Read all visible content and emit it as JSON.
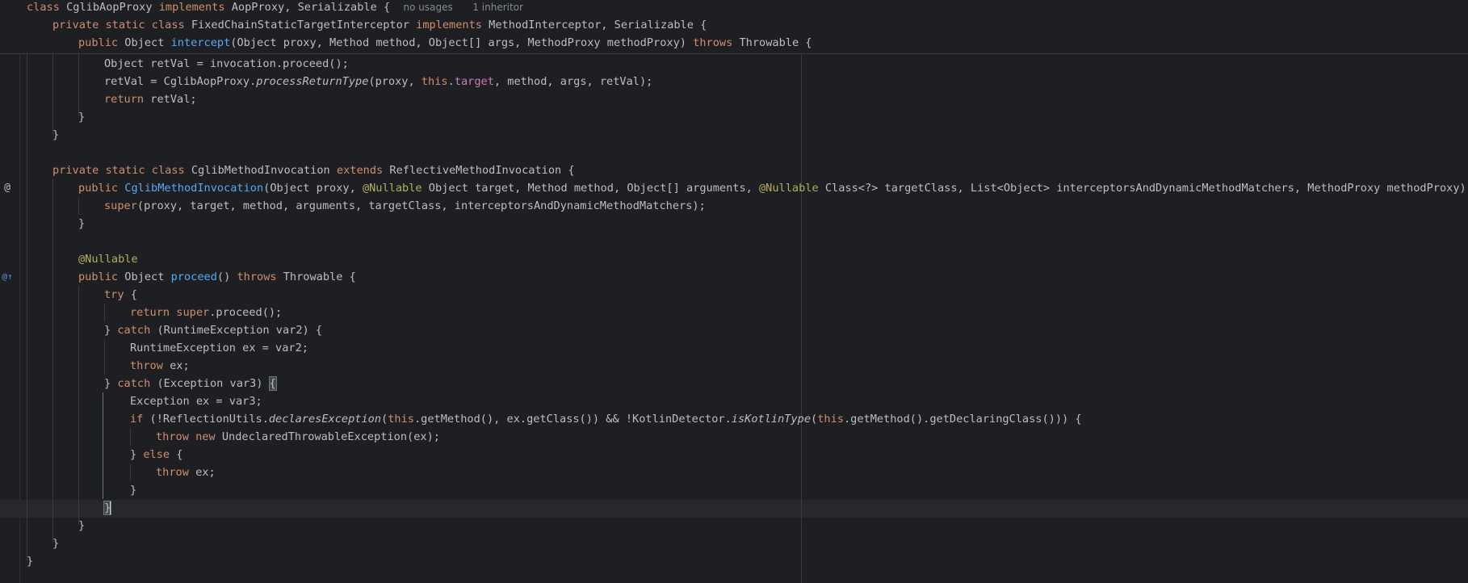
{
  "sticky": {
    "line1": {
      "kw_class": "class",
      "name": "CglibAopProxy",
      "kw_implements": "implements",
      "types": "AopProxy, Serializable {",
      "hint_usages": "no usages",
      "hint_inheritor": "1 inheritor"
    },
    "line2": {
      "kws": "private static class",
      "name": "FixedChainStaticTargetInterceptor",
      "kw_implements": "implements",
      "types": "MethodInterceptor, Serializable {"
    },
    "line3": {
      "kw_public": "public",
      "type": "Object",
      "method": "intercept",
      "params": "(Object proxy, Method method, Object[] args, MethodProxy methodProxy)",
      "kw_throws": "throws",
      "exc": "Throwable {"
    }
  },
  "code": {
    "l4": {
      "text": "Object retVal = invocation.proceed();"
    },
    "l5": {
      "a": "retVal = CglibAopProxy.",
      "italic": "processReturnType",
      "b": "(proxy, ",
      "kw_this": "this",
      "dot": ".",
      "field": "target",
      "c": ", method, args, retVal);"
    },
    "l6": {
      "kw": "return",
      "text": " retVal;"
    },
    "l7": {
      "text": "}"
    },
    "l8": {
      "text": "}"
    },
    "l9": {
      "kws": "private static class",
      "name": " CglibMethodInvocation ",
      "kw_extends": "extends",
      "rest": " ReflectiveMethodInvocation {"
    },
    "l10": {
      "kw": "public",
      "sp": " ",
      "ctor": "CglibMethodInvocation",
      "a": "(Object proxy, ",
      "an1": "@Nullable",
      "b": " Object target, Method method, Object[] arguments, ",
      "an2": "@Nullable",
      "c": " Class<?> targetClass, List<Object> interceptorsAndDynamicMethodMatchers, MethodProxy methodProxy) {"
    },
    "l11": {
      "kw": "super",
      "text": "(proxy, target, method, arguments, targetClass, interceptorsAndDynamicMethodMatchers);"
    },
    "l12": {
      "text": "}"
    },
    "l13": {
      "an": "@Nullable"
    },
    "l14": {
      "kw": "public",
      "a": " Object ",
      "fn": "proceed",
      "b": "() ",
      "kw_throws": "throws",
      "c": " Throwable {"
    },
    "l15": {
      "kw": "try",
      "text": " {"
    },
    "l16": {
      "kw1": "return",
      "sp": " ",
      "kw2": "super",
      "text": ".proceed();"
    },
    "l17": {
      "a": "} ",
      "kw": "catch",
      "b": " (RuntimeException var2) {"
    },
    "l18": {
      "text": "RuntimeException ex = var2;"
    },
    "l19": {
      "kw": "throw",
      "text": " ex;"
    },
    "l20": {
      "a": "} ",
      "kw": "catch",
      "b": " (Exception var3) ",
      "brace": "{"
    },
    "l21": {
      "text": "Exception ex = var3;"
    },
    "l22": {
      "kw_if": "if",
      "a": " (!ReflectionUtils.",
      "i1": "declaresException",
      "b": "(",
      "this1": "this",
      "c": ".getMethod(), ex.getClass()) && !KotlinDetector.",
      "i2": "isKotlinType",
      "d": "(",
      "this2": "this",
      "e": ".getMethod().getDeclaringClass())) {"
    },
    "l23": {
      "kw1": "throw",
      "sp": " ",
      "kw2": "new",
      "text": " UndeclaredThrowableException(ex);"
    },
    "l24": {
      "a": "} ",
      "kw": "else",
      "b": " {"
    },
    "l25": {
      "kw": "throw",
      "text": " ex;"
    },
    "l26": {
      "text": "}"
    },
    "l27": {
      "brace": "}"
    },
    "l28": {
      "text": "}"
    },
    "l29": {
      "text": "}"
    },
    "l30": {
      "text": "}"
    }
  },
  "gutter_icons": {
    "implementing_method": "@",
    "overriding_method": "@↑"
  },
  "colors": {
    "background": "#1e1f22",
    "keyword": "#cf8e6d",
    "method": "#56a8f5",
    "annotation": "#b3ae60",
    "field": "#c77dbb",
    "text": "#bcbec4"
  }
}
